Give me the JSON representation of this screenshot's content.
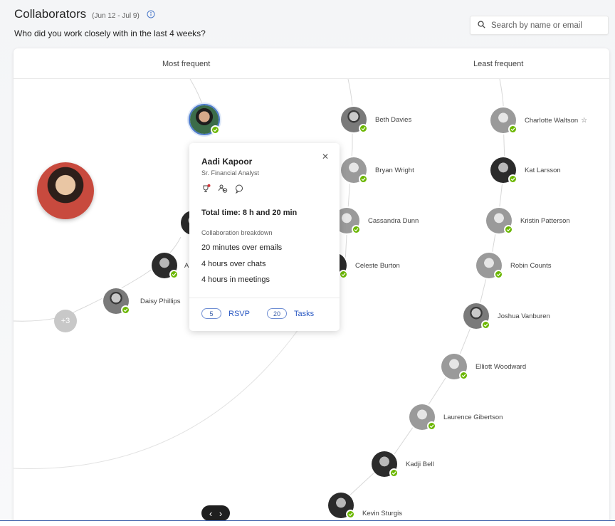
{
  "header": {
    "title": "Collaborators",
    "date_range": "(Jun 12 - Jul 9)",
    "subtitle": "Who did you work closely with in the last 4 weeks?"
  },
  "search": {
    "placeholder": "Search by name or email"
  },
  "columns": {
    "most": "Most frequent",
    "least": "Least frequent"
  },
  "more_count": "+3",
  "people": {
    "beth": "Beth Davies",
    "bryan": "Bryan Wright",
    "cassandra": "Cassandra Dunn",
    "celeste": "Celeste Burton",
    "charlotte": "Charlotte Waltson",
    "kat": "Kat Larsson",
    "kristin": "Kristin Patterson",
    "robin": "Robin Counts",
    "joshua": "Joshua Vanburen",
    "elliott": "Elliott Woodward",
    "laurence": "Laurence Gibertson",
    "kadji": "Kadji Bell",
    "kevin": "Kevin Sturgis",
    "daisy": "Daisy Phillips",
    "partial_a": "A"
  },
  "popup": {
    "name": "Aadi Kapoor",
    "role": "Sr. Financial Analyst",
    "total_time": "Total time: 8 h and 20 min",
    "breakdown_title": "Collaboration breakdown",
    "emails": "20 minutes over emails",
    "chats": "4 hours over chats",
    "meetings": "4 hours in meetings",
    "rsvp_count": "5",
    "rsvp_label": "RSVP",
    "tasks_count": "20",
    "tasks_label": "Tasks"
  },
  "pager": {
    "prev": "‹",
    "next": "›"
  },
  "colors": {
    "presence": "#6bb700",
    "accent": "#2b59c3"
  }
}
